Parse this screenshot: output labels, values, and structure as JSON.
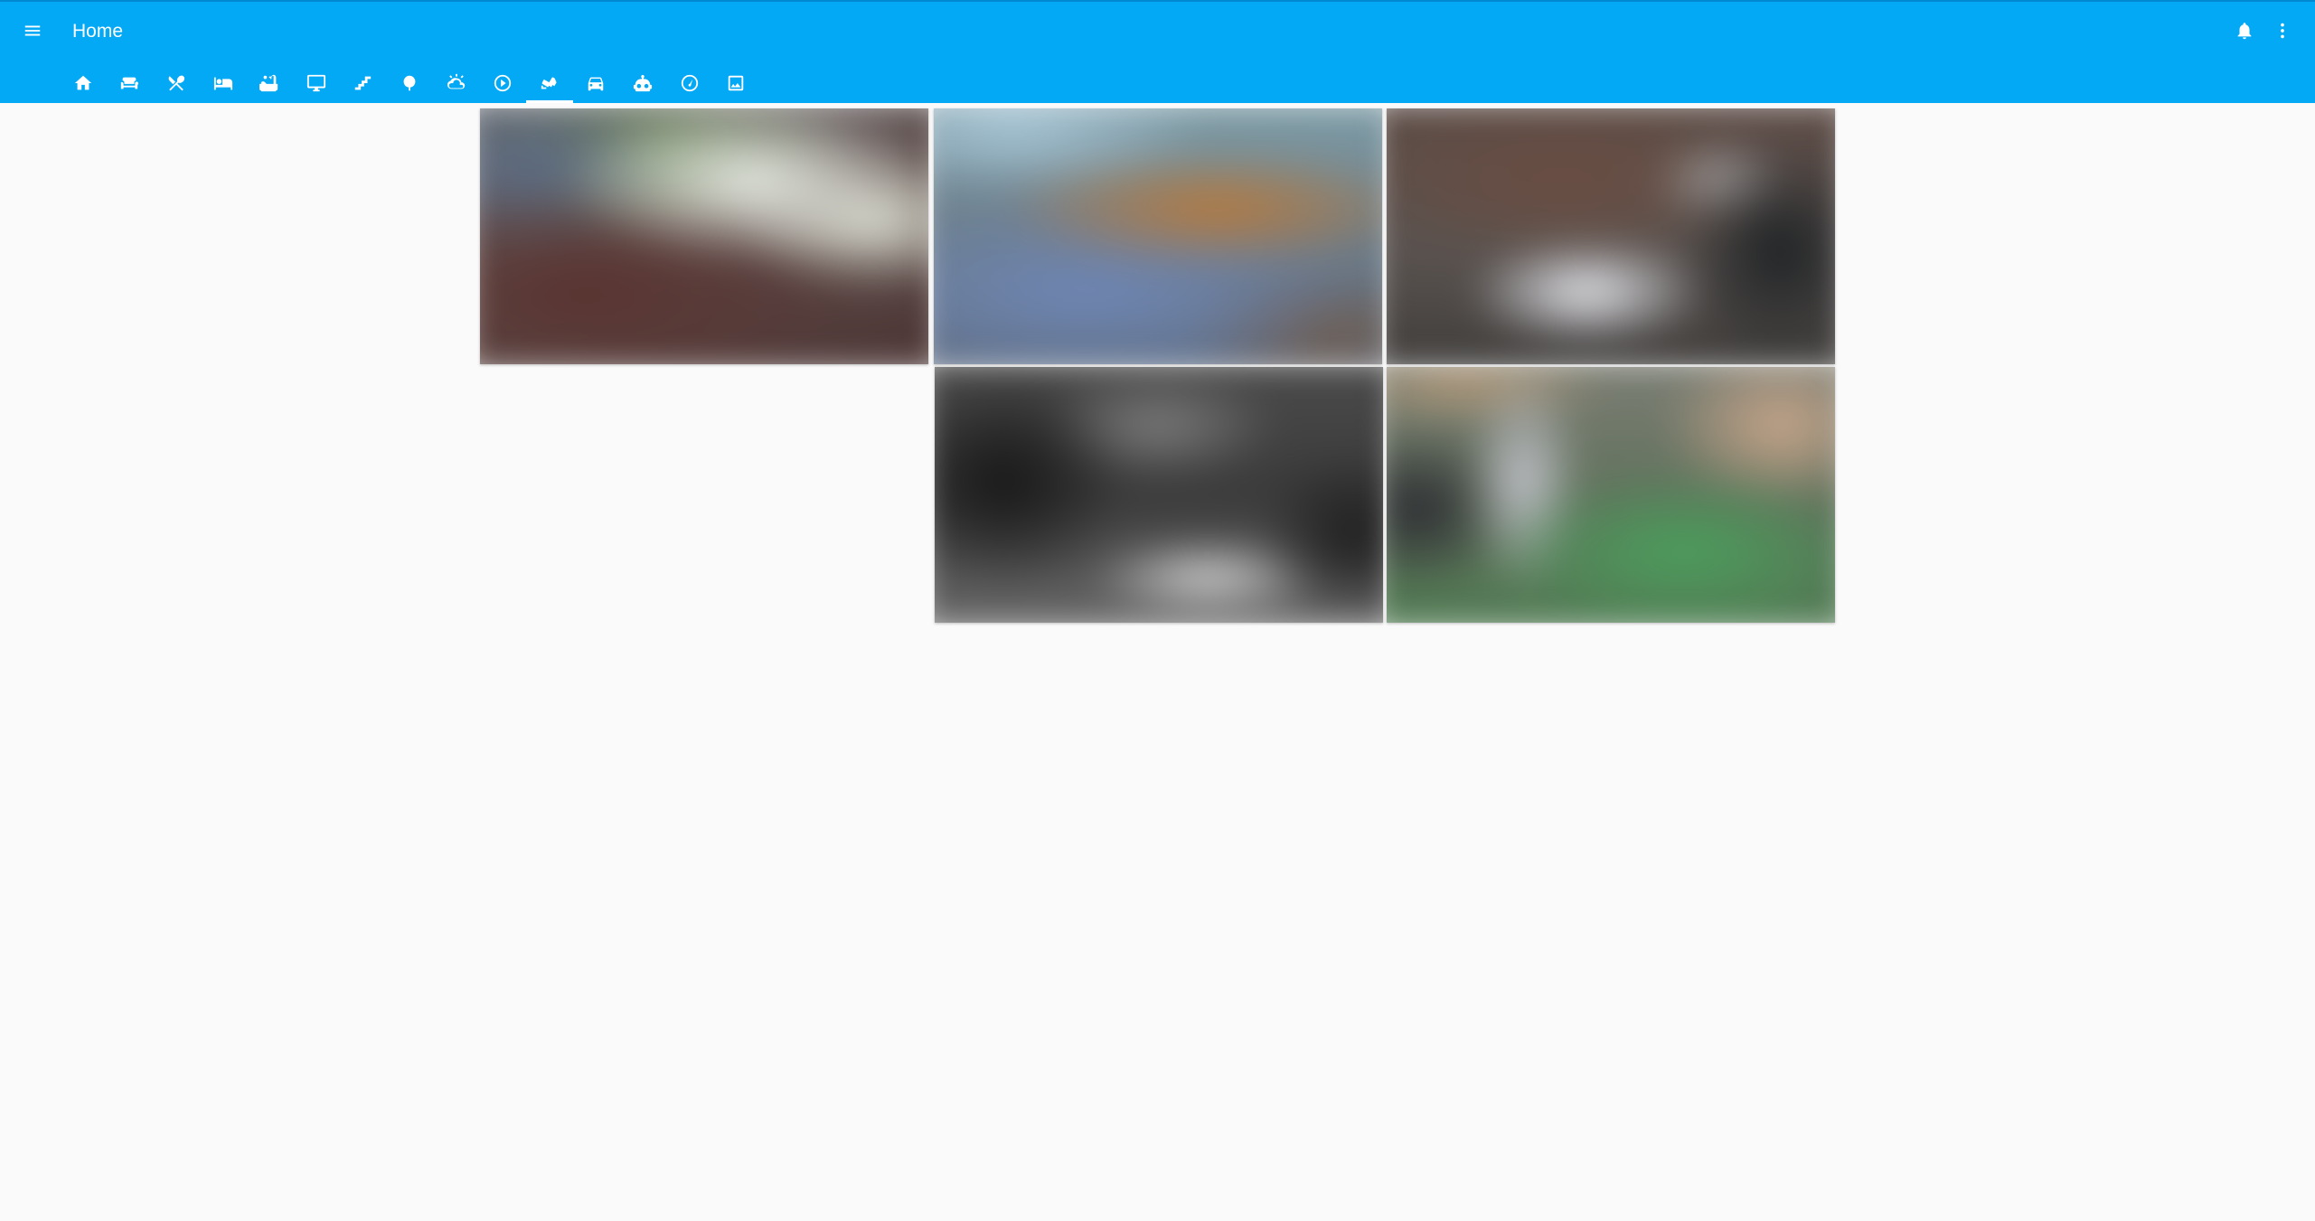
{
  "header": {
    "title": "Home",
    "background": "#03a9f4",
    "menu_icon": "menu-icon",
    "notifications_icon": "bell-icon",
    "overflow_icon": "dots-vertical-icon"
  },
  "tabs": [
    {
      "icon": "home-icon"
    },
    {
      "icon": "sofa-icon"
    },
    {
      "icon": "silverware-icon"
    },
    {
      "icon": "bed-icon"
    },
    {
      "icon": "bathtub-icon"
    },
    {
      "icon": "desktop-icon"
    },
    {
      "icon": "stairs-icon"
    },
    {
      "icon": "tree-icon"
    },
    {
      "icon": "weather-icon"
    },
    {
      "icon": "play-circle-icon"
    },
    {
      "icon": "cctv-icon",
      "active": true
    },
    {
      "icon": "car-icon"
    },
    {
      "icon": "robot-icon"
    },
    {
      "icon": "speedometer-icon"
    },
    {
      "icon": "image-frame-icon"
    }
  ],
  "cameras": [
    {
      "name": "camera-feed-1"
    },
    {
      "name": "camera-feed-2"
    },
    {
      "name": "camera-feed-3"
    },
    {
      "name": "camera-feed-4"
    },
    {
      "name": "camera-feed-5"
    }
  ]
}
